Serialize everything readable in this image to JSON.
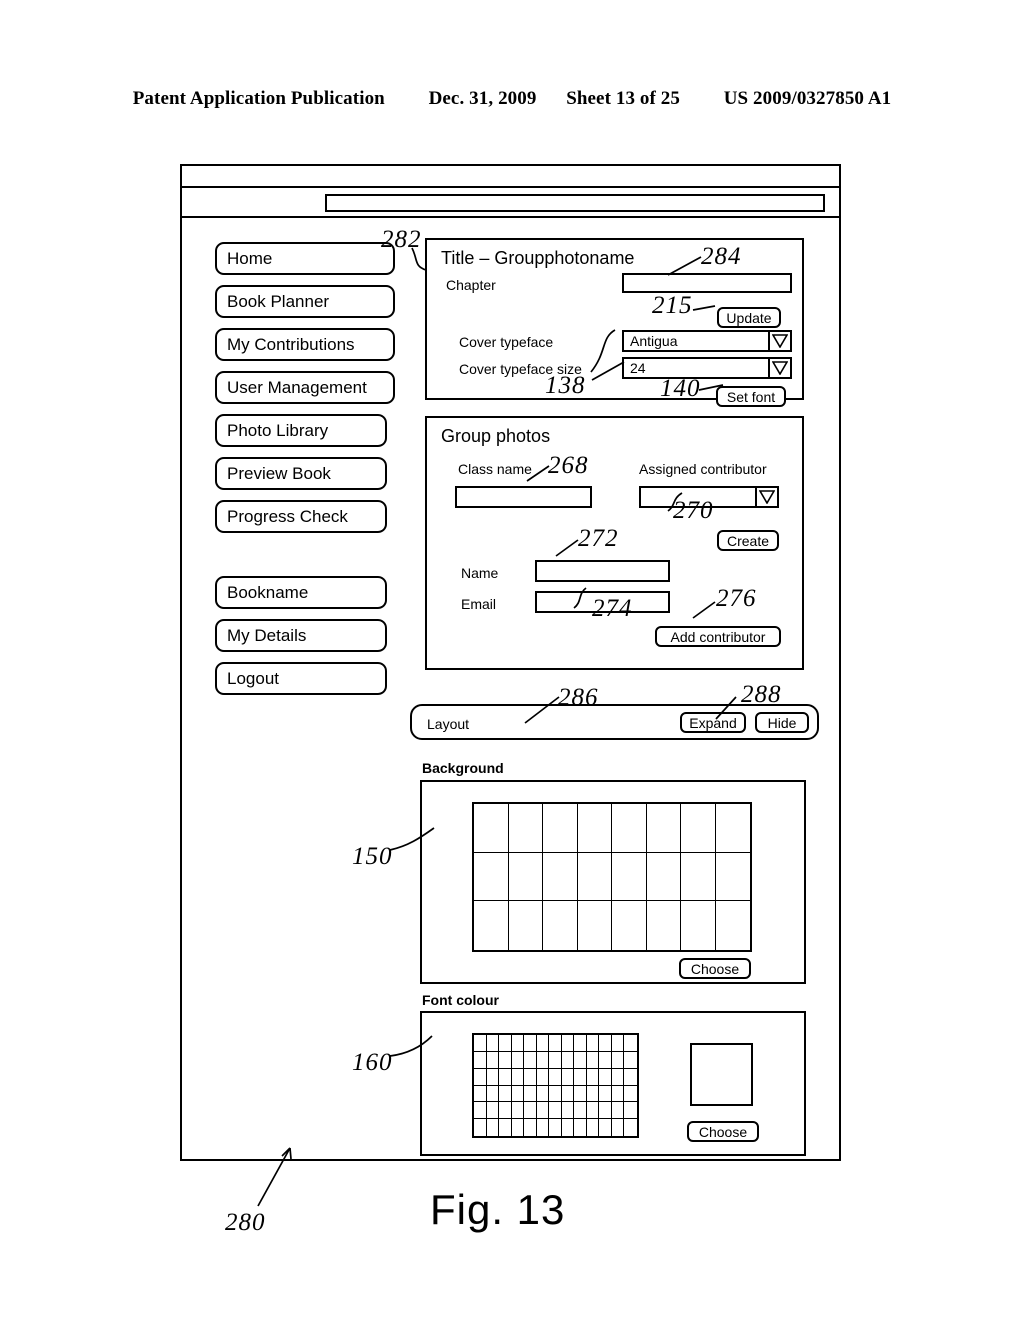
{
  "patent_header": {
    "publication": "Patent Application Publication",
    "date": "Dec. 31, 2009",
    "sheet": "Sheet 13 of 25",
    "number": "US 2009/0327850 A1"
  },
  "figure": {
    "caption": "Fig. 13",
    "window_ref": "280"
  },
  "browser": {
    "url_value": "",
    "url_placeholder": ""
  },
  "sidebar": {
    "items": [
      {
        "label": "Home"
      },
      {
        "label": "Book Planner"
      },
      {
        "label": "My Contributions"
      },
      {
        "label": "User Management"
      },
      {
        "label": "Photo Library"
      },
      {
        "label": "Preview Book"
      },
      {
        "label": "Progress Check"
      }
    ],
    "items_secondary": [
      {
        "label": "Bookname"
      },
      {
        "label": "My Details"
      },
      {
        "label": "Logout"
      }
    ]
  },
  "title_panel": {
    "ref": "282",
    "heading": "Title – Groupphotoname",
    "chapter_label": "Chapter",
    "chapter_value": "",
    "chapter_ref": "284",
    "update_label": "Update",
    "update_ref": "215",
    "typeface_label": "Cover typeface",
    "typeface_value": "Antigua",
    "typeface_ref": "138",
    "typeface_size_label": "Cover typeface size",
    "typeface_size_value": "24",
    "set_font_label": "Set font",
    "set_font_ref": "140"
  },
  "group_photos": {
    "heading": "Group photos",
    "class_name_label": "Class name",
    "class_name_value": "",
    "class_name_ref": "268",
    "assigned_contributor_label": "Assigned contributor",
    "assigned_contributor_value": "",
    "assigned_contributor_ref": "270",
    "create_label": "Create",
    "name_label": "Name",
    "name_value": "",
    "name_ref": "272",
    "email_label": "Email",
    "email_value": "",
    "email_ref": "274",
    "add_contributor_label": "Add contributor",
    "add_contributor_ref": "276"
  },
  "layout_bar": {
    "label": "Layout",
    "label_ref": "286",
    "expand_label": "Expand",
    "expand_ref": "288",
    "hide_label": "Hide"
  },
  "background_section": {
    "heading": "Background",
    "ref": "150",
    "choose_label": "Choose",
    "grid_cols": 8,
    "grid_rows": 3
  },
  "font_colour_section": {
    "heading": "Font colour",
    "ref": "160",
    "choose_label": "Choose",
    "grid_cols": 13,
    "grid_rows": 6
  }
}
